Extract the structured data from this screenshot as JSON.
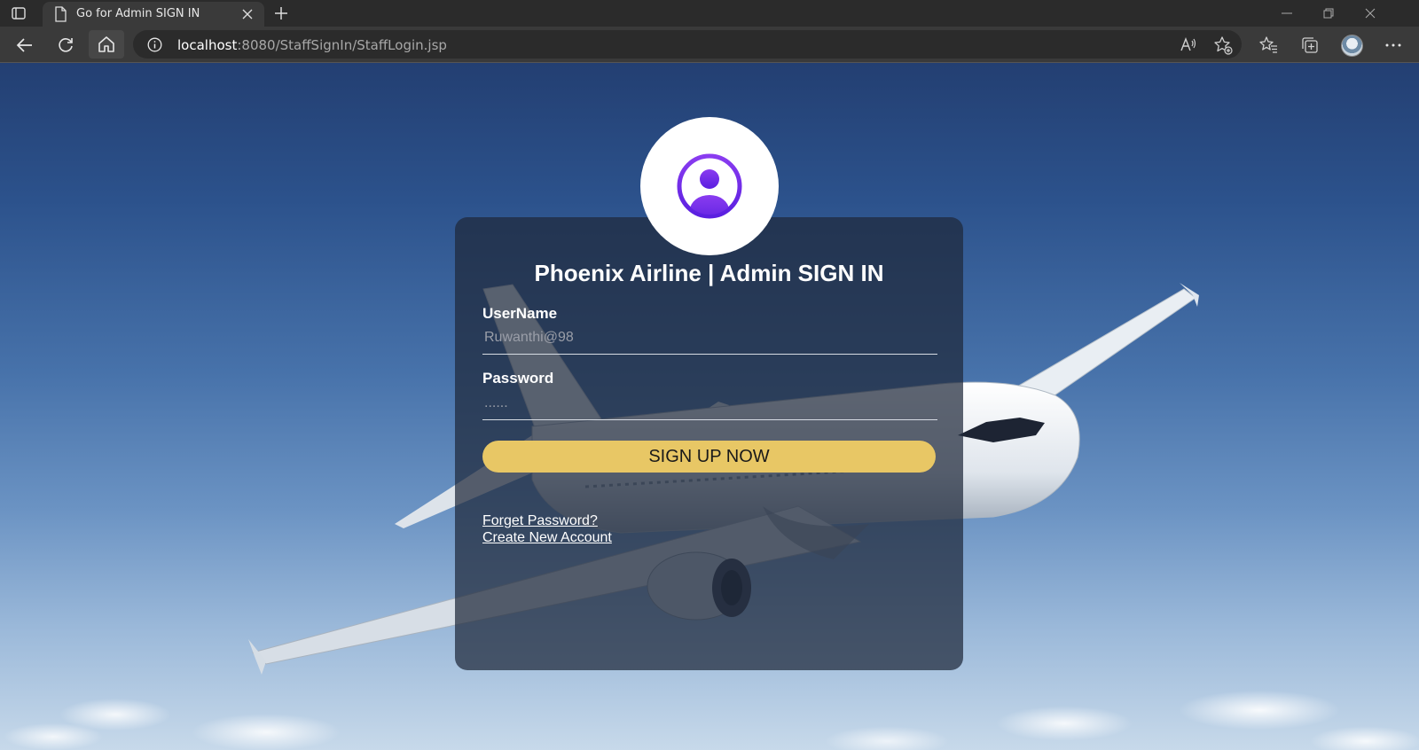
{
  "browser": {
    "tab_title": "Go for Admin SIGN IN",
    "url_host": "localhost",
    "url_path": ":8080/StaffSignIn/StaffLogin.jsp"
  },
  "form": {
    "title": "Phoenix Airline | Admin SIGN IN",
    "username_label": "UserName",
    "username_value": "Ruwanthi@98",
    "password_label": "Password",
    "password_value": "......",
    "submit_label": "SIGN UP NOW",
    "forgot_link": "Forget Password?",
    "create_link": "Create New Account"
  },
  "colors": {
    "button": "#e8c765",
    "accent_icon": "#6a2ee8"
  }
}
